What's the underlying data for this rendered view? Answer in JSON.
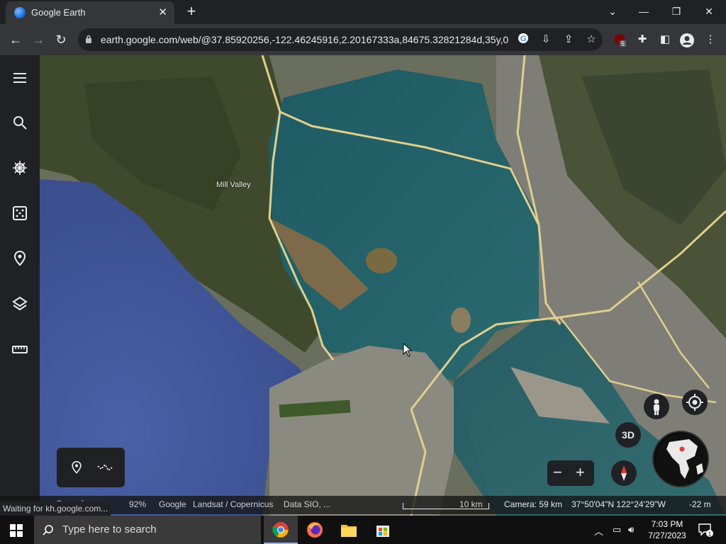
{
  "browser": {
    "tab_title": "Google Earth",
    "url": "earth.google.com/web/@37.85920256,-122.46245916,2.20167333a,84675.32821284d,35y,0...",
    "extension_badge": "5"
  },
  "map": {
    "place_label": "Mill Valley",
    "loading_status": "Waiting for kh.google.com...",
    "load_percent": "92%",
    "attribution": [
      "Google",
      "Landsat / Copernicus",
      "Data SIO, ..."
    ],
    "scale_label": "10 km",
    "camera": "Camera: 59 km",
    "coordinates": "37°50'04\"N 122°24'29\"W",
    "elevation": "-22 m",
    "view_mode": "3D",
    "watermark": "Google"
  },
  "taskbar": {
    "search_placeholder": "Type here to search",
    "time": "7:03 PM",
    "date": "7/27/2023",
    "notification_count": "1"
  }
}
